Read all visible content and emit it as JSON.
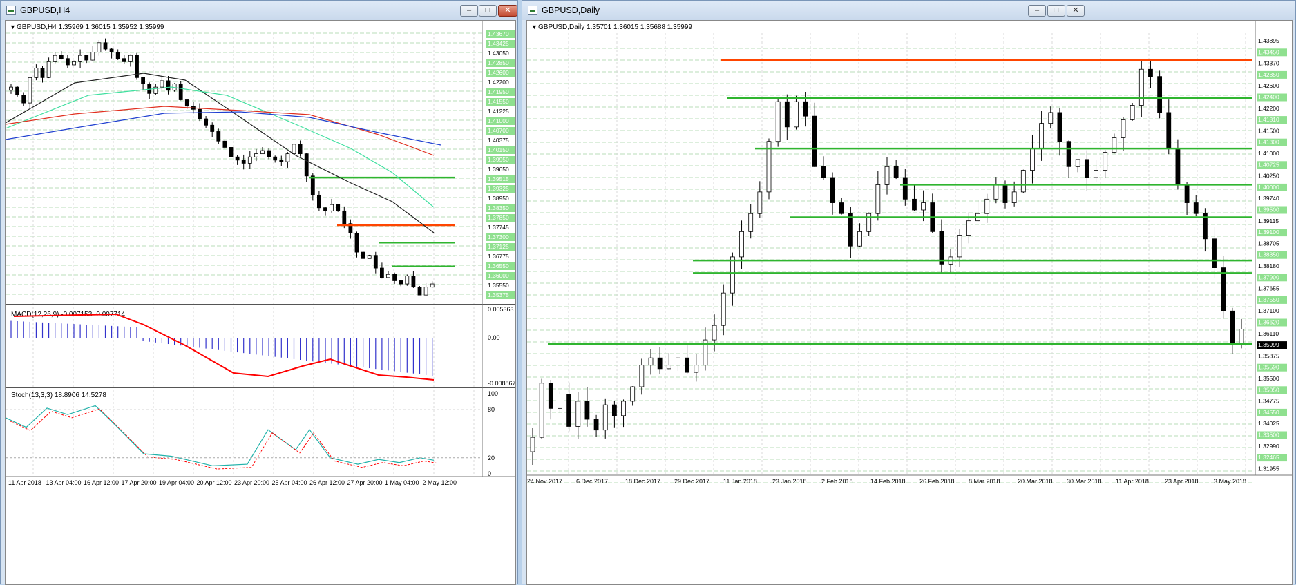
{
  "left_window": {
    "title": "GBPUSD,H4",
    "info": "GBPUSD,H4  1.35969 1.36015 1.35952 1.35999",
    "macd_label": "MACD(12,26,9) -0.007153 -0.007714",
    "stoch_label": "Stoch(13,3,3) 18.8906 14.5278",
    "macd_scale": [
      "0.005363",
      "0.00",
      "-0.008867"
    ],
    "stoch_scale": [
      "100",
      "80",
      "20",
      "0"
    ],
    "price_labels": [
      "1.43670",
      "1.43425",
      "1.43050",
      "1.42850",
      "1.42600",
      "1.42200",
      "1.41950",
      "1.41550",
      "1.41225",
      "1.41000",
      "1.40700",
      "1.40375",
      "1.40150",
      "1.39950",
      "1.39650",
      "1.39515",
      "1.39325",
      "1.38950",
      "1.38350",
      "1.37850",
      "1.37745",
      "1.37300",
      "1.37125",
      "1.36775",
      "1.36550",
      "1.36000",
      "1.35550",
      "1.35375"
    ],
    "x_labels": [
      "11 Apr 2018",
      "13 Apr 04:00",
      "16 Apr 12:00",
      "17 Apr 20:00",
      "19 Apr 04:00",
      "20 Apr 12:00",
      "23 Apr 20:00",
      "25 Apr 04:00",
      "26 Apr 12:00",
      "27 Apr 20:00",
      "1 May 04:00",
      "2 May 12:00"
    ]
  },
  "right_window": {
    "title": "GBPUSD,Daily",
    "info": "GBPUSD,Daily  1.35701 1.36015 1.35688 1.35999",
    "price_labels": [
      "1.43895",
      "1.43450",
      "1.43370",
      "1.42850",
      "1.42600",
      "1.42400",
      "1.42200",
      "1.41810",
      "1.41500",
      "1.41300",
      "1.41000",
      "1.40725",
      "1.40250",
      "1.40000",
      "1.39740",
      "1.39500",
      "1.39115",
      "1.39100",
      "1.38705",
      "1.38350",
      "1.38180",
      "1.37900",
      "1.37655",
      "1.37550",
      "1.37100",
      "1.36620",
      "1.36110",
      "1.35999",
      "1.35875",
      "1.35590",
      "1.35500",
      "1.35050",
      "1.34775",
      "1.34550",
      "1.34025",
      "1.33500",
      "1.32990",
      "1.32465",
      "1.31955"
    ],
    "x_labels": [
      "24 Nov 2017",
      "6 Dec 2017",
      "18 Dec 2017",
      "29 Dec 2017",
      "11 Jan 2018",
      "23 Jan 2018",
      "2 Feb 2018",
      "14 Feb 2018",
      "26 Feb 2018",
      "8 Mar 2018",
      "20 Mar 2018",
      "30 Mar 2018",
      "11 Apr 2018",
      "23 Apr 2018",
      "3 May 2018"
    ]
  },
  "window_buttons": {
    "minimize": "–",
    "maximize": "□",
    "close": "✕"
  },
  "colors": {
    "bull": "#ffffff",
    "bear": "#000000",
    "support": "#2fb52f",
    "resistance": "#ff4500",
    "grid": "#b8dcb8",
    "macd_hist": "#3333cc",
    "macd_signal": "#ff0000",
    "stoch_main": "#20b2aa",
    "stoch_signal": "#ff0000"
  },
  "chart_data": [
    {
      "type": "candlestick",
      "title": "GBPUSD,H4",
      "ylim": [
        1.3537,
        1.439
      ],
      "ohlc_close": [
        1.422,
        1.4195,
        1.417,
        1.425,
        1.428,
        1.425,
        1.43,
        1.432,
        1.431,
        1.429,
        1.43,
        1.432,
        1.4305,
        1.433,
        1.436,
        1.434,
        1.433,
        1.431,
        1.43,
        1.432,
        1.425,
        1.423,
        1.42,
        1.422,
        1.424,
        1.421,
        1.423,
        1.418,
        1.416,
        1.415,
        1.412,
        1.41,
        1.408,
        1.405,
        1.403,
        1.4,
        1.399,
        1.398,
        1.4,
        1.401,
        1.402,
        1.4,
        1.399,
        1.3985,
        1.401,
        1.404,
        1.401,
        1.394,
        1.388,
        1.384,
        1.383,
        1.385,
        1.383,
        1.379,
        1.376,
        1.37,
        1.368,
        1.369,
        1.365,
        1.362,
        1.363,
        1.361,
        1.36,
        1.3625,
        1.359,
        1.3565,
        1.359,
        1.36
      ],
      "levels_support": [
        1.3935,
        1.373,
        1.3655
      ],
      "levels_resistance": [
        1.3785
      ]
    },
    {
      "type": "candlestick",
      "title": "GBPUSD,Daily",
      "ylim": [
        1.3195,
        1.442
      ],
      "levels_support": [
        1.424,
        1.41,
        1.4,
        1.391,
        1.379,
        1.3755,
        1.3559
      ],
      "levels_resistance": [
        1.4345
      ]
    }
  ]
}
